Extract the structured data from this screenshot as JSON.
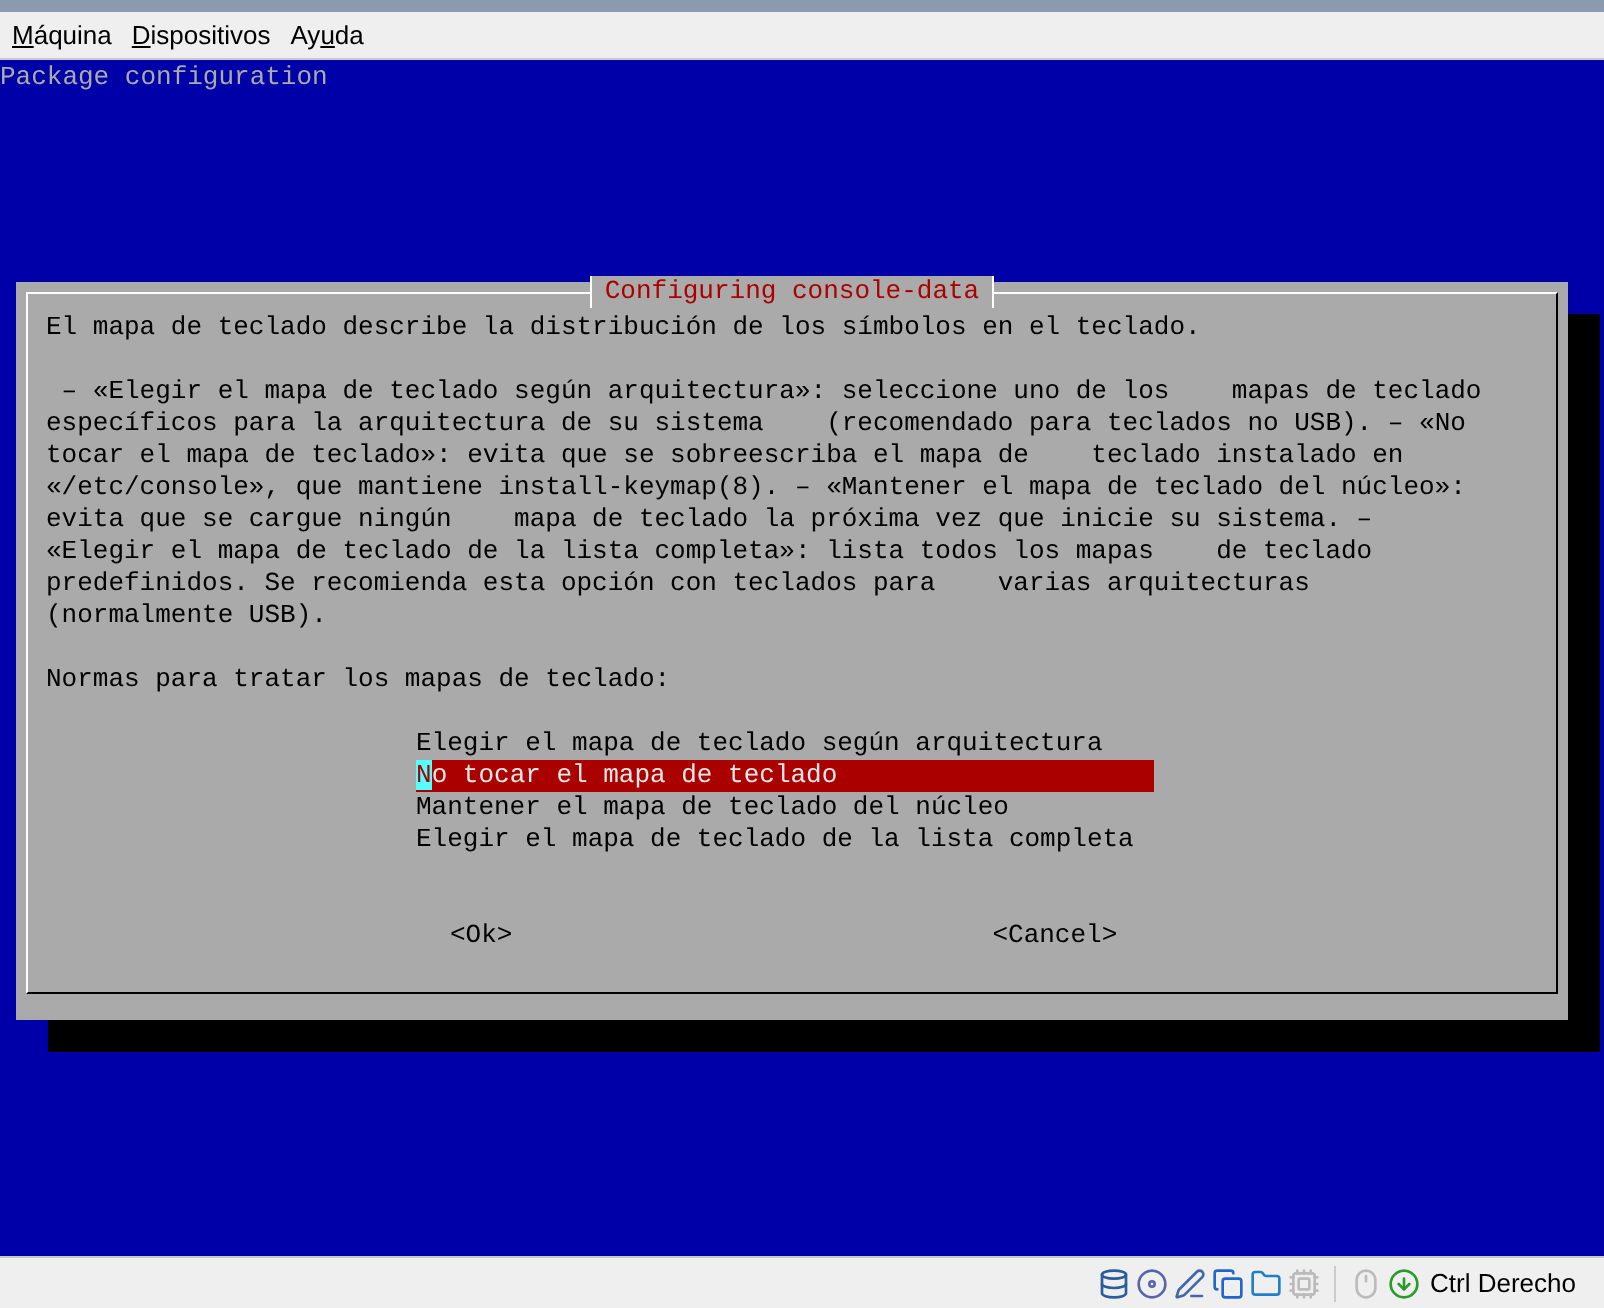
{
  "menu": [
    {
      "key": "M",
      "rest": "áquina"
    },
    {
      "key": "D",
      "rest": "ispositivos"
    },
    {
      "lead": "Ay",
      "key": "u",
      "rest": "da"
    }
  ],
  "console": {
    "header": "Package configuration",
    "dialog": {
      "title": "Configuring console-data",
      "intro": "El mapa de teclado describe la distribución de los símbolos en el teclado.",
      "description": " – «Elegir el mapa de teclado según arquitectura»: seleccione uno de los    mapas de teclado\nespecíficos para la arquitectura de su sistema    (recomendado para teclados no USB). – «No\ntocar el mapa de teclado»: evita que se sobreescriba el mapa de    teclado instalado en\n«/etc/console», que mantiene install-keymap(8). – «Mantener el mapa de teclado del núcleo»:\nevita que se cargue ningún    mapa de teclado la próxima vez que inicie su sistema. –\n«Elegir el mapa de teclado de la lista completa»: lista todos los mapas    de teclado\npredefinidos. Se recomienda esta opción con teclados para    varias arquitecturas\n(normalmente USB).",
      "prompt": "Normas para tratar los mapas de teclado:",
      "options": [
        {
          "label": "Elegir el mapa de teclado según arquitectura",
          "selected": false
        },
        {
          "label": "No tocar el mapa de teclado",
          "selected": true
        },
        {
          "label": "Mantener el mapa de teclado del núcleo",
          "selected": false
        },
        {
          "label": "Elegir el mapa de teclado de la lista completa",
          "selected": false
        }
      ],
      "buttons": [
        "<Ok>",
        "<Cancel>"
      ]
    }
  },
  "status_bar": {
    "host_key": "Ctrl Derecho"
  }
}
